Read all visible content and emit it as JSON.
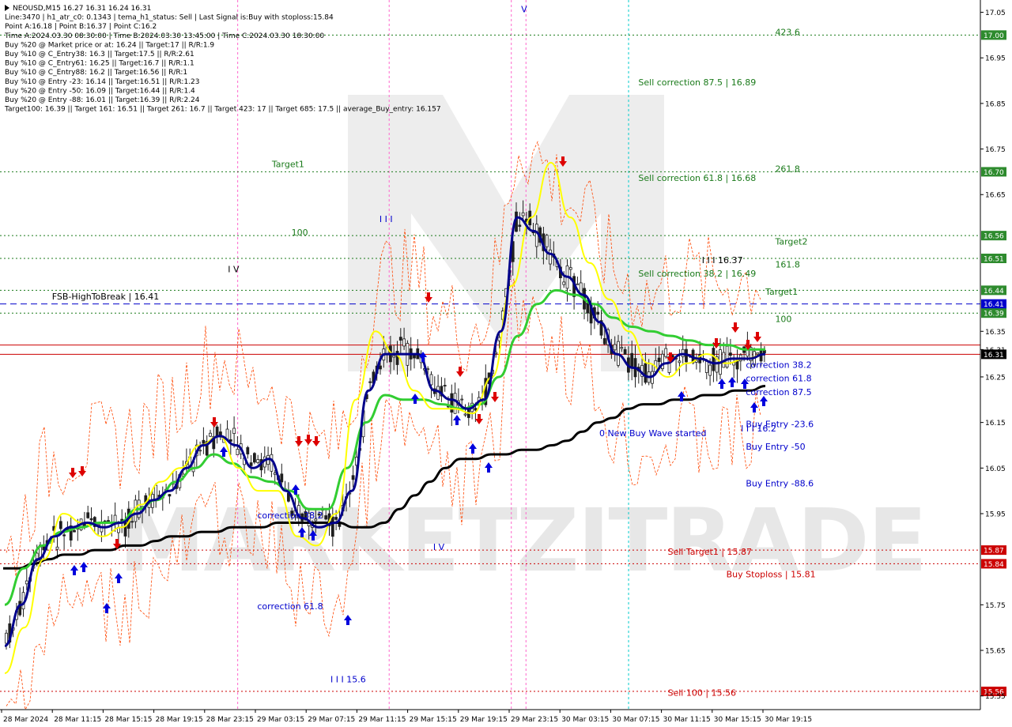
{
  "header": {
    "lines": [
      "NEOUSD,M15  16.27 16.31 16.24 16.31",
      "Line:3470  |  h1_atr_c0: 0.1343  |  tema_h1_status: Sell  |  Last Signal is:Buy with stoploss:15.84",
      "Point A:16.18  |  Point B:16.37  |  Point C:16.2",
      "Time A:2024.03.30 08:30:00  |  Time B:2024.03.30 13:45:00  |  Time C:2024.03.30 18:30:00",
      "Buy %20 @ Market price or at: 16.24  ||  Target:17  ||  R/R:1.9",
      "Buy %10 @ C_Entry38: 16.3  ||  Target:17.5  ||  R/R:2.61",
      "Buy %10 @ C_Entry61: 16.25  ||  Target:16.7  ||  R/R:1.1",
      "Buy %10 @ C_Entry88: 16.2  ||  Target:16.56  ||  R/R:1",
      "Buy %10 @ Entry -23: 16.14  ||  Target:16.51  ||  R/R:1.23",
      "Buy %20 @ Entry -50: 16.09  ||  Target:16.44  ||  R/R:1.4",
      "Buy %20 @ Entry -88: 16.01  ||  Target:16.39  ||  R/R:2.24",
      "Target100: 16.39  ||  Target 161: 16.51  ||  Target 261: 16.7  ||  Target 423: 17  ||  Target 685: 17.5  ||  average_Buy_entry: 16.157"
    ]
  },
  "colors": {
    "background": "#ffffff",
    "candle": "#1f1f1f",
    "green_line": "#1a7a1a",
    "red_line": "#cc0000",
    "blue_line": "#0000cc",
    "ma_black": "#000000",
    "ma_navy": "#00008b",
    "ma_green": "#32cd32",
    "ma_yellow": "#ffff00",
    "envelope": "#ff4500",
    "tag_green": "#2e8b2e",
    "tag_red": "#cc0000",
    "tag_blue": "#0000cc",
    "tag_black": "#000000",
    "arrow_up": "#0000dd",
    "arrow_down": "#dd0000",
    "vline_pink": "#ff66cc",
    "vline_cyan": "#00cccc",
    "watermark": "#cccccc"
  },
  "chart_data": {
    "type": "line",
    "symbol": "NEOUSD",
    "timeframe": "M15",
    "ylim": [
      15.52,
      17.07
    ],
    "y_ticks": [
      "17.05",
      "17.00",
      "16.95",
      "16.85",
      "16.75",
      "16.70",
      "16.65",
      "16.56",
      "16.51",
      "16.44",
      "16.41",
      "16.39",
      "16.35",
      "16.31",
      "16.25",
      "16.15",
      "16.05",
      "15.95",
      "15.87",
      "15.84",
      "15.75",
      "15.65",
      "15.56",
      "15.55"
    ],
    "x_ticks": [
      "28 Mar 2024",
      "28 Mar 11:15",
      "28 Mar 15:15",
      "28 Mar 19:15",
      "28 Mar 23:15",
      "29 Mar 03:15",
      "29 Mar 07:15",
      "29 Mar 11:15",
      "29 Mar 15:15",
      "29 Mar 19:15",
      "29 Mar 23:15",
      "30 Mar 03:15",
      "30 Mar 07:15",
      "30 Mar 11:15",
      "30 Mar 15:15",
      "30 Mar 19:15"
    ],
    "current_price": 16.31,
    "levels": [
      {
        "price": 17.0,
        "tag": "17.00",
        "color": "green",
        "style": "dotted"
      },
      {
        "price": 16.7,
        "tag": "16.70",
        "color": "green",
        "style": "dotted"
      },
      {
        "price": 16.56,
        "tag": "16.56",
        "color": "green",
        "style": "dotted"
      },
      {
        "price": 16.51,
        "tag": "16.51",
        "color": "green",
        "style": "dotted"
      },
      {
        "price": 16.44,
        "tag": "16.44",
        "color": "green",
        "style": "dotted"
      },
      {
        "price": 16.41,
        "tag": "16.41",
        "color": "blue",
        "style": "dashed"
      },
      {
        "price": 16.39,
        "tag": "16.39",
        "color": "green",
        "style": "dotted"
      },
      {
        "price": 16.32,
        "tag": "16.32",
        "color": "red",
        "style": "solid"
      },
      {
        "price": 15.87,
        "tag": "15.87",
        "color": "red",
        "style": "dotted"
      },
      {
        "price": 15.84,
        "tag": "15.84",
        "color": "red",
        "style": "dotted"
      },
      {
        "price": 15.56,
        "tag": "15.56",
        "color": "red",
        "style": "dotted"
      }
    ],
    "annotations": [
      {
        "text": "423.6",
        "price": 17.0,
        "x_frac": 0.79,
        "color": "green"
      },
      {
        "text": "Sell correction 87.5 | 16.89",
        "price": 16.89,
        "x_frac": 0.65,
        "color": "green"
      },
      {
        "text": "Sell correction 61.8 | 16.68",
        "price": 16.68,
        "x_frac": 0.65,
        "color": "green"
      },
      {
        "text": "261.8",
        "price": 16.7,
        "x_frac": 0.79,
        "color": "green"
      },
      {
        "text": "Target1",
        "price": 16.71,
        "x_frac": 0.275,
        "color": "green"
      },
      {
        "text": "100",
        "price": 16.56,
        "x_frac": 0.295,
        "color": "green"
      },
      {
        "text": "Target2",
        "price": 16.54,
        "x_frac": 0.79,
        "color": "green"
      },
      {
        "text": "I I I 16.37",
        "price": 16.5,
        "x_frac": 0.715,
        "color": "black"
      },
      {
        "text": "161.8",
        "price": 16.49,
        "x_frac": 0.79,
        "color": "green"
      },
      {
        "text": "Sell correction 38.2 | 16.49",
        "price": 16.47,
        "x_frac": 0.65,
        "color": "green"
      },
      {
        "text": "Target1",
        "price": 16.43,
        "x_frac": 0.78,
        "color": "green"
      },
      {
        "text": "FSB-HighToBreak | 16.41",
        "price": 16.42,
        "x_frac": 0.05,
        "color": "black"
      },
      {
        "text": "100",
        "price": 16.37,
        "x_frac": 0.79,
        "color": "green"
      },
      {
        "text": "I V",
        "price": 16.48,
        "x_frac": 0.23,
        "color": "black"
      },
      {
        "text": "I I I",
        "price": 16.59,
        "x_frac": 0.385,
        "color": "blue"
      },
      {
        "text": "V",
        "price": 17.05,
        "x_frac": 0.53,
        "color": "blue"
      },
      {
        "text": "0 New Buy Wave started",
        "price": 16.12,
        "x_frac": 0.61,
        "color": "blue"
      },
      {
        "text": "Buy Entry -23.6",
        "price": 16.14,
        "x_frac": 0.76,
        "color": "blue"
      },
      {
        "text": "I I I 16.2",
        "price": 16.13,
        "x_frac": 0.755,
        "color": "blue"
      },
      {
        "text": "Buy Entry -50",
        "price": 16.09,
        "x_frac": 0.76,
        "color": "blue"
      },
      {
        "text": "Buy Entry -88.6",
        "price": 16.01,
        "x_frac": 0.76,
        "color": "blue"
      },
      {
        "text": "correction 38.2",
        "price": 15.94,
        "x_frac": 0.26,
        "color": "blue"
      },
      {
        "text": "correction 61.8",
        "price": 15.74,
        "x_frac": 0.26,
        "color": "blue"
      },
      {
        "text": "correction 38.2",
        "price": 16.27,
        "x_frac": 0.76,
        "color": "blue"
      },
      {
        "text": "correction 61.8",
        "price": 16.24,
        "x_frac": 0.76,
        "color": "blue"
      },
      {
        "text": "correction 87.5",
        "price": 16.21,
        "x_frac": 0.76,
        "color": "blue"
      },
      {
        "text": "I V",
        "price": 15.87,
        "x_frac": 0.44,
        "color": "blue"
      },
      {
        "text": "Sell Target1 | 15.87",
        "price": 15.86,
        "x_frac": 0.68,
        "color": "red"
      },
      {
        "text": "Buy Stoploss | 15.81",
        "price": 15.81,
        "x_frac": 0.74,
        "color": "red"
      },
      {
        "text": "I I I 15.6",
        "price": 15.58,
        "x_frac": 0.335,
        "color": "blue"
      },
      {
        "text": "Sell 100 | 15.56",
        "price": 15.55,
        "x_frac": 0.68,
        "color": "red"
      }
    ],
    "vertical_lines": [
      {
        "x_frac": 0.24,
        "color": "pink"
      },
      {
        "x_frac": 0.395,
        "color": "pink"
      },
      {
        "x_frac": 0.52,
        "color": "pink"
      },
      {
        "x_frac": 0.535,
        "color": "pink"
      },
      {
        "x_frac": 0.64,
        "color": "cyan"
      }
    ],
    "ma_black": [
      15.83,
      15.83,
      15.84,
      15.85,
      15.86,
      15.86,
      15.87,
      15.87,
      15.88,
      15.88,
      15.89,
      15.9,
      15.9,
      15.91,
      15.91,
      15.92,
      15.92,
      15.92,
      15.93,
      15.93,
      15.93,
      15.93,
      15.93,
      15.92,
      15.92,
      15.93,
      15.96,
      15.99,
      16.02,
      16.05,
      16.07,
      16.07,
      16.08,
      16.08,
      16.09,
      16.09,
      16.1,
      16.11,
      16.13,
      16.15,
      16.16,
      16.18,
      16.19,
      16.19,
      16.2,
      16.2,
      16.21,
      16.21,
      16.22,
      16.22,
      16.23
    ],
    "ma_navy": [
      15.66,
      15.75,
      15.85,
      15.9,
      15.92,
      15.93,
      15.92,
      15.93,
      15.95,
      15.98,
      16.0,
      16.05,
      16.1,
      16.12,
      16.1,
      16.05,
      16.07,
      16.0,
      15.94,
      15.92,
      15.93,
      16.0,
      16.22,
      16.3,
      16.3,
      16.3,
      16.22,
      16.2,
      16.18,
      16.2,
      16.35,
      16.6,
      16.57,
      16.52,
      16.47,
      16.43,
      16.37,
      16.3,
      16.27,
      16.25,
      16.28,
      16.3,
      16.29,
      16.28,
      16.29,
      16.29,
      16.3
    ],
    "ma_green": [
      15.75,
      15.83,
      15.88,
      15.91,
      15.92,
      15.93,
      15.93,
      15.96,
      15.98,
      16.02,
      16.05,
      16.08,
      16.06,
      16.03,
      16.02,
      16.0,
      15.96,
      15.96,
      16.05,
      16.15,
      16.21,
      16.2,
      16.2,
      16.19,
      16.18,
      16.19,
      16.25,
      16.34,
      16.41,
      16.44,
      16.43,
      16.41,
      16.38,
      16.36,
      16.35,
      16.34,
      16.33,
      16.32,
      16.32,
      16.31,
      16.31
    ],
    "ma_yellow": [
      15.6,
      15.7,
      15.85,
      15.95,
      15.93,
      15.9,
      15.92,
      15.97,
      16.02,
      16.05,
      16.1,
      16.12,
      16.05,
      16.0,
      16.0,
      15.9,
      15.88,
      15.95,
      16.2,
      16.35,
      16.3,
      16.22,
      16.18,
      16.18,
      16.17,
      16.25,
      16.45,
      16.6,
      16.72,
      16.6,
      16.5,
      16.42,
      16.35,
      16.28,
      16.25,
      16.28,
      16.3,
      16.28,
      16.29,
      16.3
    ]
  },
  "watermark": {
    "text": "MARKETZITRADE"
  }
}
